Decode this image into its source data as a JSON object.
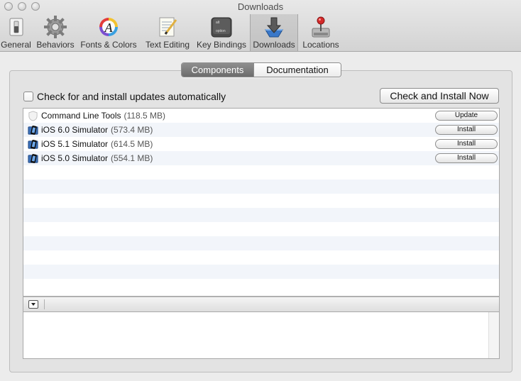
{
  "window": {
    "title": "Downloads"
  },
  "toolbar": {
    "items": [
      {
        "label": "General",
        "icon": "general-switch-icon"
      },
      {
        "label": "Behaviors",
        "icon": "gear-icon"
      },
      {
        "label": "Fonts & Colors",
        "icon": "fonts-colors-icon"
      },
      {
        "label": "Text Editing",
        "icon": "text-editing-icon"
      },
      {
        "label": "Key Bindings",
        "icon": "key-bindings-icon"
      },
      {
        "label": "Downloads",
        "icon": "downloads-icon",
        "selected": true
      },
      {
        "label": "Locations",
        "icon": "locations-icon"
      }
    ]
  },
  "tabs": [
    {
      "label": "Components",
      "active": true
    },
    {
      "label": "Documentation",
      "active": false
    }
  ],
  "auto_update": {
    "label": "Check for and install updates automatically",
    "checked": false
  },
  "check_now_button": {
    "label": "Check and Install Now"
  },
  "components": [
    {
      "name": "Command Line Tools",
      "size": "(118.5 MB)",
      "action": "Update",
      "icon": "command-line-tools-icon"
    },
    {
      "name": "iOS 6.0 Simulator",
      "size": "(573.4 MB)",
      "action": "Install",
      "icon": "ios-simulator-icon"
    },
    {
      "name": "iOS 5.1 Simulator",
      "size": "(614.5 MB)",
      "action": "Install",
      "icon": "ios-simulator-icon"
    },
    {
      "name": "iOS 5.0 Simulator",
      "size": "(554.1 MB)",
      "action": "Install",
      "icon": "ios-simulator-icon"
    }
  ],
  "key_bindings_icon_text": {
    "top": "alt",
    "bottom": "option"
  },
  "colors": {
    "selected_segment": "#7a7a7a",
    "row_alt": "#f2f5fa",
    "accent_blue": "#3a78c9"
  }
}
